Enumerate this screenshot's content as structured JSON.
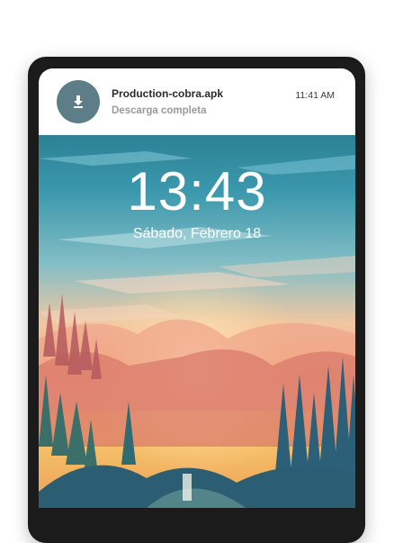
{
  "notification": {
    "title": "Production-cobra.apk",
    "subtitle": "Descarga completa",
    "time": "11:41 AM",
    "icon": "download-icon"
  },
  "lockscreen": {
    "time": "13:43",
    "date": "Sábado, Febrero 18"
  },
  "colors": {
    "icon_background": "#5d7e89",
    "sky_top": "#1d6c80",
    "sky_bottom": "#f7b57a"
  }
}
